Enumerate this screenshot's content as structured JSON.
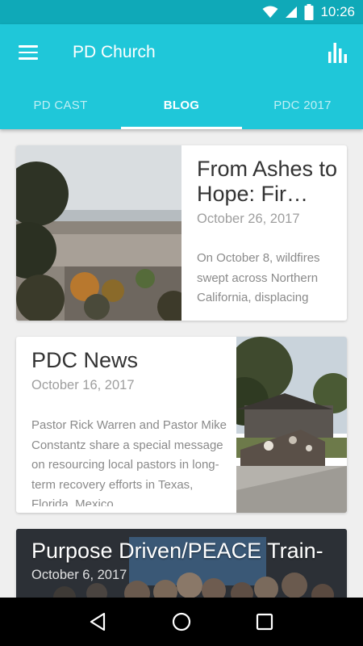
{
  "status_bar": {
    "time": "10:26",
    "icons": [
      "wifi-icon",
      "cell-signal-icon",
      "battery-icon"
    ]
  },
  "app_bar": {
    "title": "PD Church",
    "menu_icon": "hamburger-menu-icon",
    "action_icon": "bar-chart-icon"
  },
  "tabs": [
    {
      "label": "PD CAST",
      "active": false
    },
    {
      "label": "BLOG",
      "active": true
    },
    {
      "label": "PDC 2017",
      "active": false
    }
  ],
  "posts": [
    {
      "title": "From Ashes to Hope: Fir…",
      "date": "October 26, 2017",
      "excerpt": "On October 8, wildfires swept across Northern California, displacing"
    },
    {
      "title": "PDC News",
      "date": "October 16, 2017",
      "excerpt": "Pastor Rick Warren and Pastor Mike Constantz share a special message on resourcing local pastors in long-term recovery efforts in Texas, Florida, Mexico"
    },
    {
      "title": "Purpose Driven/PEACE Train-",
      "date": "October 6, 2017"
    }
  ],
  "nav_bar": {
    "icons": [
      "back-icon",
      "home-icon",
      "recents-icon"
    ]
  },
  "colors": {
    "primary": "#1fc7d9",
    "status_bar": "#0fa9b8",
    "background": "#efefef"
  }
}
